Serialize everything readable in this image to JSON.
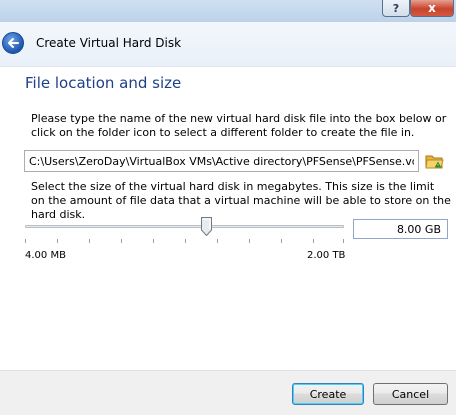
{
  "window": {
    "help_label": "?",
    "close_label": "x"
  },
  "header": {
    "title": "Create Virtual Hard Disk"
  },
  "main": {
    "section_title": "File location and size",
    "location_instruction": "Please type the name of the new virtual hard disk file into the box below or click on the folder icon to select a different folder to create the file in.",
    "file_path": "C:\\Users\\ZeroDay\\VirtualBox VMs\\Active directory\\PFSense\\PFSense.vdi",
    "size_instruction": "Select the size of the virtual hard disk in megabytes. This size is the limit on the amount of file data that a virtual machine will be able to store on the hard disk.",
    "size_value": "8.00 GB",
    "slider_min_label": "4.00 MB",
    "slider_max_label": "2.00 TB",
    "slider_fraction": 0.57
  },
  "footer": {
    "create_label": "Create",
    "cancel_label": "Cancel"
  },
  "icons": {
    "back": "back-arrow-icon",
    "folder": "folder-icon"
  },
  "colors": {
    "section_title": "#1e3f8b",
    "accent": "#3c7fb1"
  }
}
